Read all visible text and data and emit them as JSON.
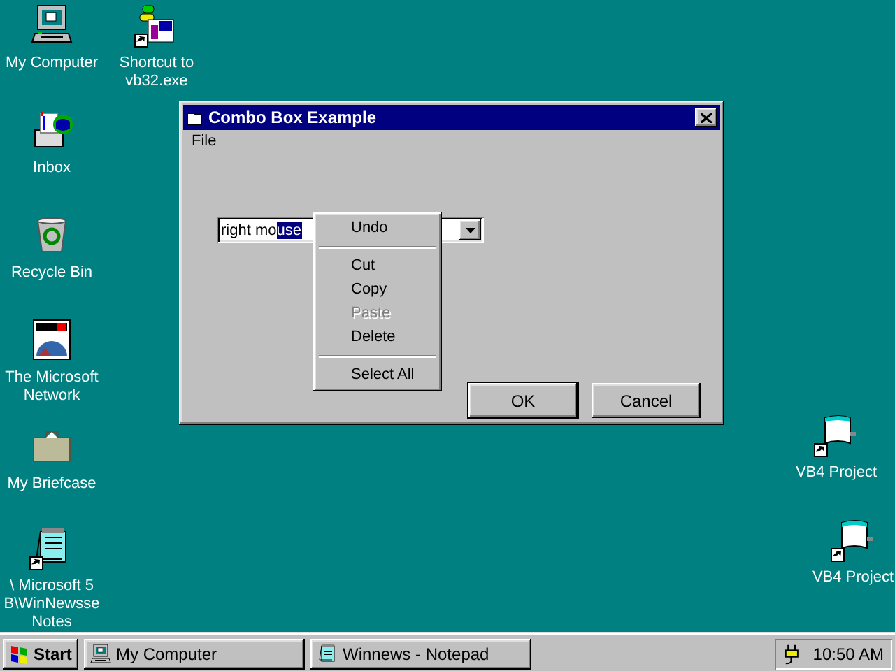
{
  "desktop_icons": [
    {
      "label": "My Computer",
      "kind": "computer",
      "shortcut": false
    },
    {
      "label": "Shortcut to\nvb32.exe",
      "kind": "setup",
      "shortcut": true
    },
    {
      "label": "Inbox",
      "kind": "inbox",
      "shortcut": false
    },
    {
      "label": "Recycle Bin",
      "kind": "recycle",
      "shortcut": false
    },
    {
      "label": "The Microsoft\nNetwork",
      "kind": "msn",
      "shortcut": false
    },
    {
      "label": "My Briefcase",
      "kind": "briefcase",
      "shortcut": false
    },
    {
      "label": "\\ Microsoft 5\nB\\WinNewsse\nNotes",
      "kind": "notepad",
      "shortcut": true
    },
    {
      "label": "VB4 Project",
      "kind": "flag",
      "shortcut": true
    },
    {
      "label": "VB4 Project",
      "kind": "flag",
      "shortcut": true
    }
  ],
  "window": {
    "title": "Combo Box Example",
    "menu": [
      "File"
    ],
    "combo": {
      "text_before": "right mo",
      "selection": "use"
    },
    "context_menu": [
      {
        "kind": "item",
        "label": "Undo",
        "disabled": false
      },
      {
        "kind": "separator"
      },
      {
        "kind": "item",
        "label": "Cut",
        "disabled": false
      },
      {
        "kind": "item",
        "label": "Copy",
        "disabled": false
      },
      {
        "kind": "item",
        "label": "Paste",
        "disabled": true
      },
      {
        "kind": "item",
        "label": "Delete",
        "disabled": false
      },
      {
        "kind": "separator"
      },
      {
        "kind": "item",
        "label": "Select All",
        "disabled": false
      }
    ],
    "buttons": [
      {
        "label": "OK",
        "default": true
      },
      {
        "label": "Cancel",
        "default": false
      }
    ]
  },
  "taskbar": {
    "start": "Start",
    "tasks": [
      {
        "label": "My Computer",
        "kind": "computer",
        "selected": false
      },
      {
        "label": "Winnews - Notepad",
        "kind": "notepad",
        "selected": false
      }
    ],
    "clock": "10:50 AM"
  }
}
